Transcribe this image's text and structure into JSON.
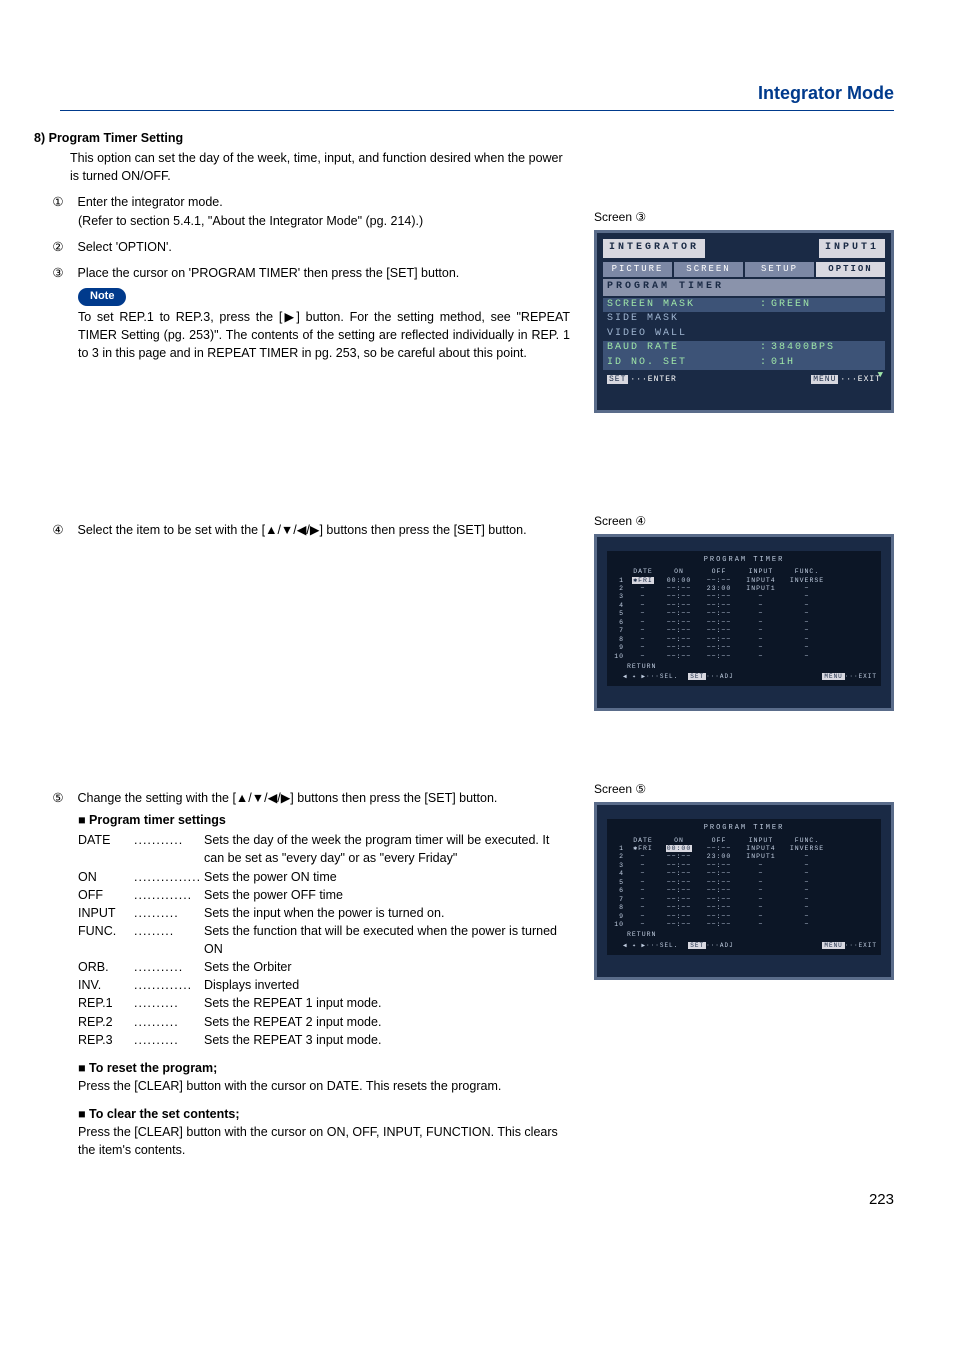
{
  "page_title": "Integrator Mode",
  "section_number": "8)",
  "section_title": "Program Timer Setting",
  "section_intro": "This option can set the day of the week, time, input, and function desired when the power is turned ON/OFF.",
  "steps": {
    "s1_num": "①",
    "s1_text": "Enter the integrator mode.",
    "s1_sub": "(Refer to section 5.4.1, \"About the Integrator Mode\" (pg. 214).)",
    "s2_num": "②",
    "s2_text": "Select 'OPTION'.",
    "s3_num": "③",
    "s3_text": "Place the cursor on 'PROGRAM TIMER' then press the [SET] button.",
    "s4_num": "④",
    "s4_text": "Select the item to be set with the [▲/▼/◀/▶] buttons then press the [SET] button.",
    "s5_num": "⑤",
    "s5_text": "Change the setting with the [▲/▼/◀/▶] buttons then press the [SET] button."
  },
  "note_label": "Note",
  "note_body": "To set REP.1 to REP.3, press the [▶] button. For the setting method, see \"REPEAT TIMER Setting (pg. 253)\". The contents of the setting are reflected individually in REP. 1 to 3 in this page and in REPEAT TIMER in pg. 253, so be careful about this point.",
  "screen_labels": {
    "s3": "Screen ③",
    "s4": "Screen ④",
    "s5": "Screen ⑤"
  },
  "osd3": {
    "title": "INTEGRATOR",
    "input": "INPUT1",
    "tabs": [
      "PICTURE",
      "SCREEN",
      "SETUP",
      "OPTION"
    ],
    "active_tab_index": 3,
    "group": "PROGRAM TIMER",
    "items": [
      {
        "label": "SCREEN MASK",
        "value": "GREEN",
        "hl": true
      },
      {
        "label": "SIDE MASK",
        "value": "",
        "hl": false
      },
      {
        "label": "VIDEO WALL",
        "value": "",
        "hl": false
      },
      {
        "label": "BAUD RATE",
        "value": "38400BPS",
        "hl": true
      },
      {
        "label": "ID NO. SET",
        "value": "01H",
        "hl": true
      }
    ],
    "footer_left_key": "SET",
    "footer_left_label": "···ENTER",
    "footer_right_key": "MENU",
    "footer_right_label": "···EXIT",
    "scroll_arrow": "▼"
  },
  "pt_common": {
    "title": "PROGRAM TIMER",
    "headers": [
      "DATE",
      "ON",
      "OFF",
      "INPUT",
      "FUNC."
    ],
    "return_label": "RETURN",
    "footer_sel": "◀ ✦ ▶···SEL.",
    "footer_adj_key": "SET",
    "footer_adj_label": "···ADJ",
    "footer_exit_key": "MENU",
    "footer_exit_label": "···EXIT"
  },
  "pt4_rows": [
    {
      "idx": "1",
      "date": "✱FRI",
      "on": "00:00",
      "off": "−−:−−",
      "input": "INPUT4",
      "func": "INVERSE",
      "date_hl": true,
      "on_hl": false
    },
    {
      "idx": "2",
      "date": "−",
      "on": "−−:−−",
      "off": "23:00",
      "input": "INPUT1",
      "func": "−"
    },
    {
      "idx": "3",
      "date": "−",
      "on": "−−:−−",
      "off": "−−:−−",
      "input": "−",
      "func": "−"
    },
    {
      "idx": "4",
      "date": "−",
      "on": "−−:−−",
      "off": "−−:−−",
      "input": "−",
      "func": "−"
    },
    {
      "idx": "5",
      "date": "−",
      "on": "−−:−−",
      "off": "−−:−−",
      "input": "−",
      "func": "−"
    },
    {
      "idx": "6",
      "date": "−",
      "on": "−−:−−",
      "off": "−−:−−",
      "input": "−",
      "func": "−"
    },
    {
      "idx": "7",
      "date": "−",
      "on": "−−:−−",
      "off": "−−:−−",
      "input": "−",
      "func": "−"
    },
    {
      "idx": "8",
      "date": "−",
      "on": "−−:−−",
      "off": "−−:−−",
      "input": "−",
      "func": "−"
    },
    {
      "idx": "9",
      "date": "−",
      "on": "−−:−−",
      "off": "−−:−−",
      "input": "−",
      "func": "−"
    },
    {
      "idx": "10",
      "date": "−",
      "on": "−−:−−",
      "off": "−−:−−",
      "input": "−",
      "func": "−"
    }
  ],
  "pt5_rows": [
    {
      "idx": "1",
      "date": "✱FRI",
      "on": "00:00",
      "off": "−−:−−",
      "input": "INPUT4",
      "func": "INVERSE",
      "on_hl": true
    },
    {
      "idx": "2",
      "date": "−",
      "on": "−−:−−",
      "off": "23:00",
      "input": "INPUT1",
      "func": "−"
    },
    {
      "idx": "3",
      "date": "−",
      "on": "−−:−−",
      "off": "−−:−−",
      "input": "−",
      "func": "−"
    },
    {
      "idx": "4",
      "date": "−",
      "on": "−−:−−",
      "off": "−−:−−",
      "input": "−",
      "func": "−"
    },
    {
      "idx": "5",
      "date": "−",
      "on": "−−:−−",
      "off": "−−:−−",
      "input": "−",
      "func": "−"
    },
    {
      "idx": "6",
      "date": "−",
      "on": "−−:−−",
      "off": "−−:−−",
      "input": "−",
      "func": "−"
    },
    {
      "idx": "7",
      "date": "−",
      "on": "−−:−−",
      "off": "−−:−−",
      "input": "−",
      "func": "−"
    },
    {
      "idx": "8",
      "date": "−",
      "on": "−−:−−",
      "off": "−−:−−",
      "input": "−",
      "func": "−"
    },
    {
      "idx": "9",
      "date": "−",
      "on": "−−:−−",
      "off": "−−:−−",
      "input": "−",
      "func": "−"
    },
    {
      "idx": "10",
      "date": "−",
      "on": "−−:−−",
      "off": "−−:−−",
      "input": "−",
      "func": "−"
    }
  ],
  "settings": {
    "heading": "■ Program timer settings",
    "items": [
      {
        "term": "DATE",
        "dots": "...........",
        "desc": "Sets the day of the week the program timer will be executed. It can be set as \"every day\" or as \"every Friday\""
      },
      {
        "term": "ON",
        "dots": "...............",
        "desc": "Sets the power ON time"
      },
      {
        "term": "OFF",
        "dots": ".............",
        "desc": "Sets the power OFF time"
      },
      {
        "term": "INPUT",
        "dots": "..........",
        "desc": "Sets the input when the power is turned on."
      },
      {
        "term": "FUNC.",
        "dots": ".........",
        "desc": "Sets the function that will be executed when the power is turned ON"
      },
      {
        "term": "ORB.",
        "dots": "...........",
        "desc": "Sets the Orbiter"
      },
      {
        "term": "INV.",
        "dots": ".............",
        "desc": "Displays inverted"
      },
      {
        "term": "REP.1",
        "dots": "..........",
        "desc": "Sets the REPEAT 1 input mode."
      },
      {
        "term": "REP.2",
        "dots": "..........",
        "desc": "Sets the REPEAT 2 input mode."
      },
      {
        "term": "REP.3",
        "dots": "..........",
        "desc": "Sets the REPEAT 3 input mode."
      }
    ]
  },
  "reset": {
    "heading": "■ To reset the program;",
    "body": "Press the [CLEAR] button with the cursor on DATE. This resets the program."
  },
  "clear": {
    "heading": "■ To clear the set contents;",
    "body": "Press the [CLEAR] button with the cursor on ON, OFF, INPUT, FUNCTION. This clears the item's contents."
  },
  "page_number": "223"
}
